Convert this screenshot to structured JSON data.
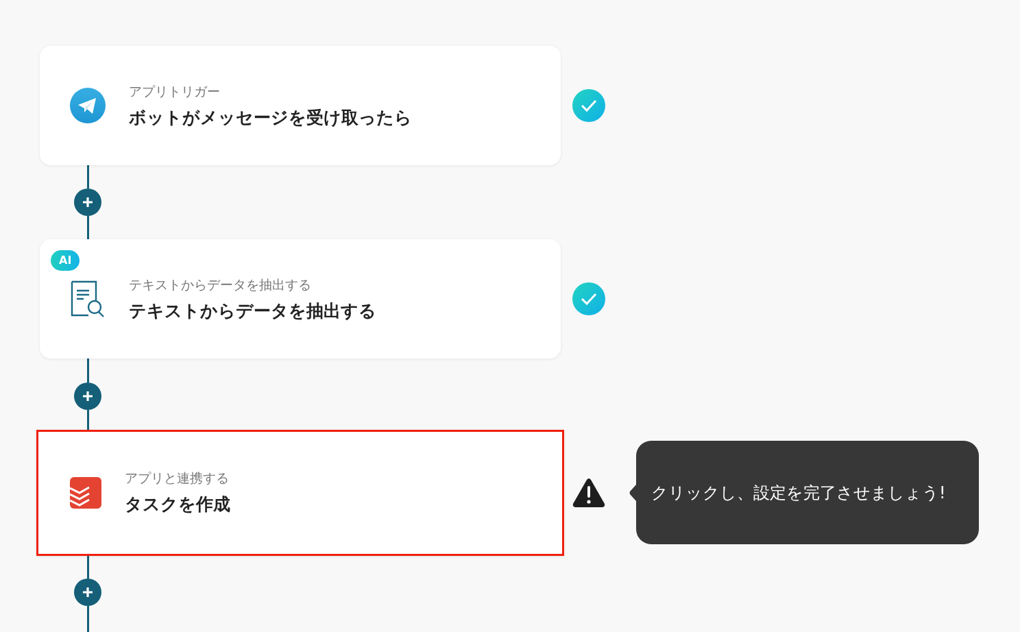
{
  "steps": [
    {
      "kind": "telegram",
      "caption": "アプリトリガー",
      "title": "ボットがメッセージを受け取ったら",
      "done": true,
      "highlighted": false
    },
    {
      "kind": "extract",
      "badge": "AI",
      "caption": "テキストからデータを抽出する",
      "title": "テキストからデータを抽出する",
      "done": true,
      "highlighted": false
    },
    {
      "kind": "todoist",
      "caption": "アプリと連携する",
      "title": "タスクを作成",
      "done": false,
      "highlighted": true,
      "tooltip": "クリックし、設定を完了させましょう!"
    }
  ]
}
